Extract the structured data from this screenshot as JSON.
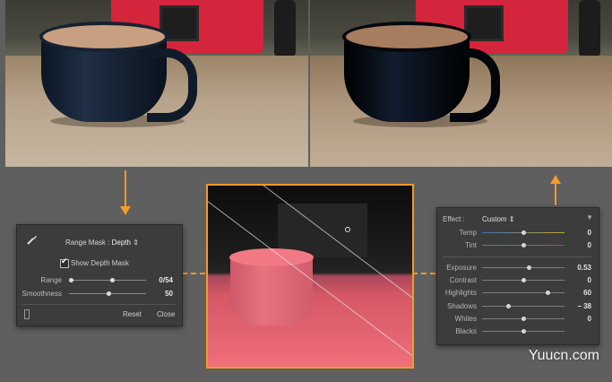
{
  "range_mask_panel": {
    "label": "Range Mask :",
    "value": "Depth",
    "show_depth_mask_label": "Show Depth Mask",
    "show_depth_mask_checked": true,
    "range_label": "Range",
    "range_value": "0/54",
    "smoothness_label": "Smoothness",
    "smoothness_value": "50",
    "reset_label": "Reset",
    "close_label": "Close"
  },
  "effect_panel": {
    "effect_label": "Effect :",
    "effect_value": "Custom",
    "sliders": [
      {
        "label": "Temp",
        "value": "0"
      },
      {
        "label": "Tint",
        "value": "0"
      },
      {
        "label": "Exposure",
        "value": "0.53"
      },
      {
        "label": "Contrast",
        "value": "0"
      },
      {
        "label": "Highlights",
        "value": "60"
      },
      {
        "label": "Shadows",
        "value": "− 38"
      },
      {
        "label": "Whites",
        "value": "0"
      },
      {
        "label": "Blacks",
        "value": ""
      }
    ]
  },
  "watermark": "Yuucn.com",
  "colors": {
    "accent": "#f29b26",
    "panel": "#3c3c3c",
    "mask_pink": "#ef6f7a"
  }
}
